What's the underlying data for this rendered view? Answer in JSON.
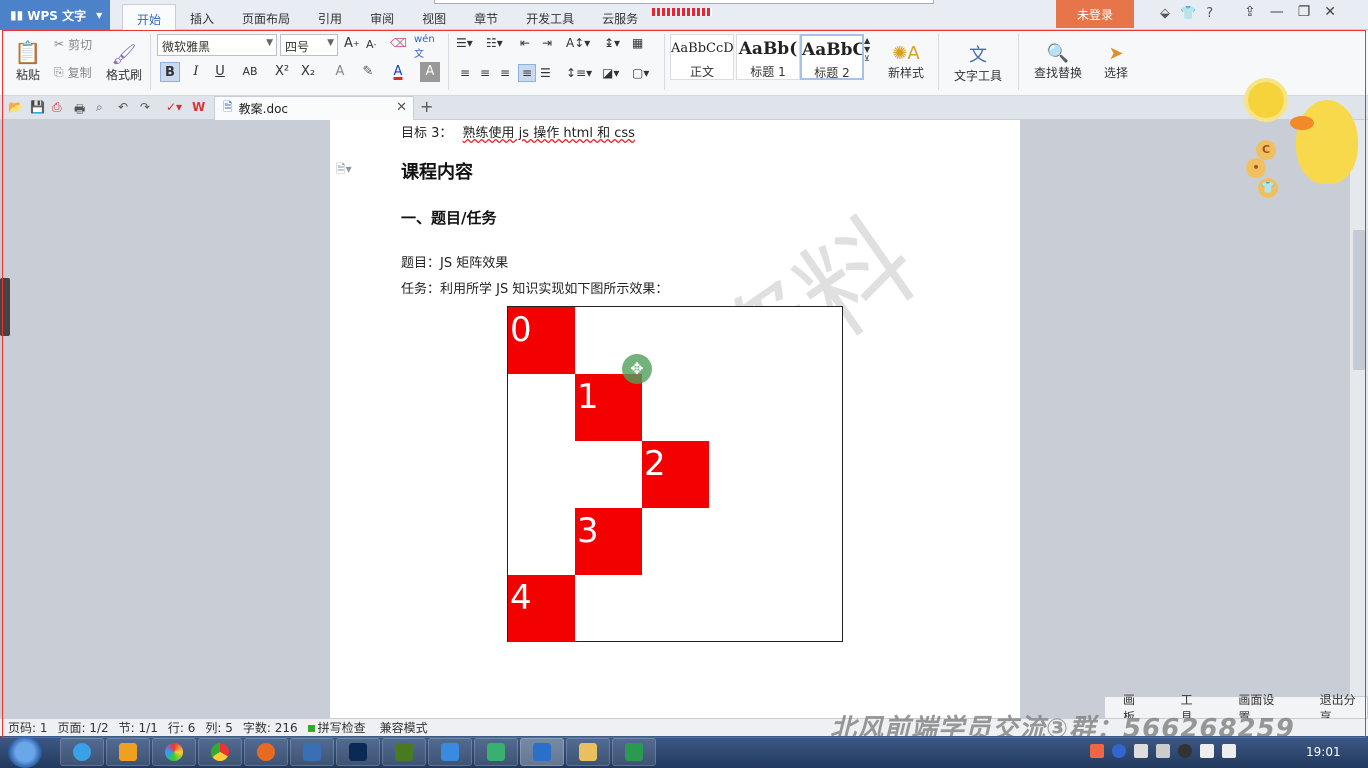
{
  "titlebar": {
    "app_name": "WPS 文字",
    "menu": [
      "开始",
      "插入",
      "页面布局",
      "引用",
      "审阅",
      "视图",
      "章节",
      "开发工具",
      "云服务"
    ],
    "active_menu": "开始",
    "login": "未登录",
    "tools": [
      "⬙",
      "👕",
      "?"
    ]
  },
  "ribbon": {
    "paste": "粘贴",
    "cut": "剪切",
    "copy": "复制",
    "format_painter": "格式刷",
    "font_name": "微软雅黑",
    "font_size": "四号",
    "styles": [
      {
        "sample": "AaBbCcD",
        "name": "正文"
      },
      {
        "sample": "AaBb(",
        "name": "标题 1"
      },
      {
        "sample": "AaBbC",
        "name": "标题 2"
      }
    ],
    "new_style": "新样式",
    "text_tools": "文字工具",
    "find_replace": "查找替换",
    "select": "选择"
  },
  "tabbar": {
    "doc_name": "教案.doc"
  },
  "document": {
    "goal_line_prefix": "目标 3：",
    "goal_line_text": "熟练使用 js 操作 html 和 css",
    "heading1": "课程内容",
    "heading2": "一、题目/任务",
    "topic": "题目：JS 矩阵效果",
    "task": "任务：利用所学 JS 知识实现如下图所示效果：",
    "watermark": "资料",
    "matrix_cells": [
      "0",
      "1",
      "2",
      "3",
      "4"
    ]
  },
  "panel": {
    "items": [
      "画板",
      "工具",
      "画面设置",
      "退出分享"
    ]
  },
  "statusbar": {
    "page_num": "页码: 1",
    "page": "页面: 1/2",
    "section": "节: 1/1",
    "row": "行: 6",
    "col": "列: 5",
    "words": "字数: 216",
    "spell": "拼写检查",
    "compat": "兼容模式"
  },
  "overlay": "北风前端学员交流③群：566268259",
  "taskbar": {
    "clock": "19:01"
  }
}
